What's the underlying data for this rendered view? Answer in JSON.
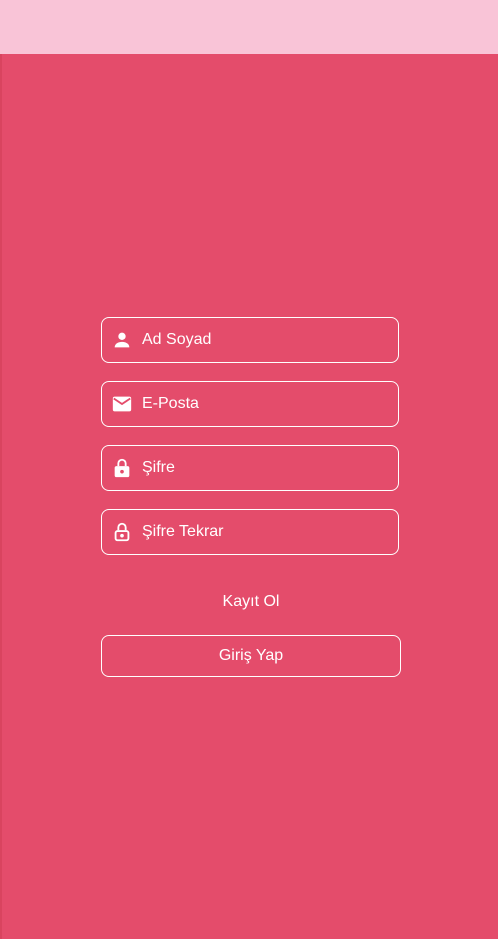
{
  "colors": {
    "background": "#e44c6b",
    "status_bar": "#f9c4d7",
    "foreground": "#ffffff"
  },
  "form": {
    "fields": [
      {
        "icon": "person-icon",
        "placeholder": "Ad Soyad"
      },
      {
        "icon": "mail-icon",
        "placeholder": "E-Posta"
      },
      {
        "icon": "lock-icon",
        "placeholder": "Şifre"
      },
      {
        "icon": "lock-outline-icon",
        "placeholder": "Şifre Tekrar"
      }
    ],
    "register_label": "Kayıt Ol",
    "login_label": "Giriş Yap"
  }
}
